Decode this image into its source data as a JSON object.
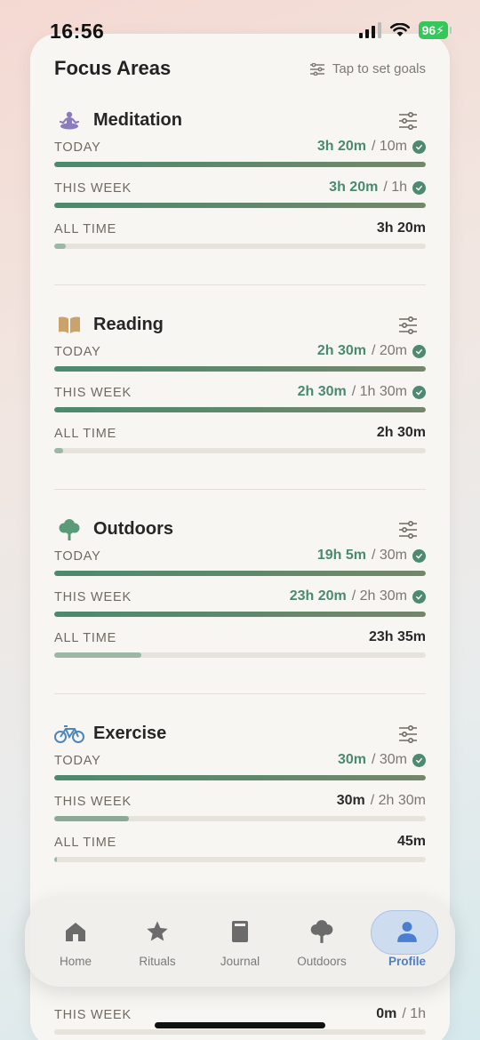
{
  "status": {
    "time": "16:56",
    "battery": "96"
  },
  "header": {
    "title": "Focus Areas",
    "goals_label": "Tap to set goals"
  },
  "sections": [
    {
      "name": "Meditation",
      "rows": [
        {
          "label": "TODAY",
          "value": "3h 20m",
          "goal": "10m",
          "done": true,
          "progress": 1.0
        },
        {
          "label": "THIS WEEK",
          "value": "3h 20m",
          "goal": "1h",
          "done": true,
          "progress": 1.0
        },
        {
          "label": "ALL TIME",
          "value": "3h 20m",
          "goal": "",
          "done": false,
          "progress": 0.03
        }
      ]
    },
    {
      "name": "Reading",
      "rows": [
        {
          "label": "TODAY",
          "value": "2h 30m",
          "goal": "20m",
          "done": true,
          "progress": 1.0
        },
        {
          "label": "THIS WEEK",
          "value": "2h 30m",
          "goal": "1h 30m",
          "done": true,
          "progress": 1.0
        },
        {
          "label": "ALL TIME",
          "value": "2h 30m",
          "goal": "",
          "done": false,
          "progress": 0.025
        }
      ]
    },
    {
      "name": "Outdoors",
      "rows": [
        {
          "label": "TODAY",
          "value": "19h 5m",
          "goal": "30m",
          "done": true,
          "progress": 1.0
        },
        {
          "label": "THIS WEEK",
          "value": "23h 20m",
          "goal": "2h 30m",
          "done": true,
          "progress": 1.0
        },
        {
          "label": "ALL TIME",
          "value": "23h 35m",
          "goal": "",
          "done": false,
          "progress": 0.235
        }
      ]
    },
    {
      "name": "Exercise",
      "rows": [
        {
          "label": "TODAY",
          "value": "30m",
          "goal": "30m",
          "done": true,
          "progress": 1.0
        },
        {
          "label": "THIS WEEK",
          "value": "30m",
          "goal": "2h 30m",
          "done": false,
          "progress": 0.2
        },
        {
          "label": "ALL TIME",
          "value": "45m",
          "goal": "",
          "done": false,
          "progress": 0.005
        }
      ]
    }
  ],
  "partial_row": {
    "label": "THIS WEEK",
    "value": "0m",
    "goal": "1h"
  },
  "tabs": [
    {
      "label": "Home",
      "icon": "home-icon"
    },
    {
      "label": "Rituals",
      "icon": "star-icon"
    },
    {
      "label": "Journal",
      "icon": "book-icon"
    },
    {
      "label": "Outdoors",
      "icon": "tree-icon"
    },
    {
      "label": "Profile",
      "icon": "person-icon",
      "active": true
    }
  ],
  "colors": {
    "accent": "#4f8a70",
    "tab_active": "#4a7fcf"
  }
}
